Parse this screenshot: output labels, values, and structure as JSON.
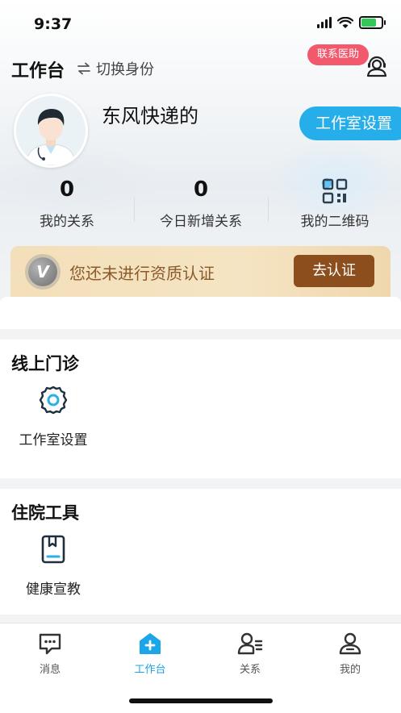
{
  "status_bar": {
    "time": "9:37"
  },
  "header": {
    "title": "工作台",
    "switch_label": "切换身份",
    "contact_label": "联系医助"
  },
  "profile": {
    "name": "东风快递的",
    "studio_button": "工作室设置"
  },
  "stats": [
    {
      "value": "0",
      "label": "我的关系"
    },
    {
      "value": "0",
      "label": "今日新增关系"
    },
    {
      "value": "",
      "label": "我的二维码"
    }
  ],
  "certification": {
    "badge": "V",
    "text": "您还未进行资质认证",
    "button": "去认证"
  },
  "sections": {
    "online_clinic": {
      "title": "线上门诊",
      "items": [
        {
          "label": "工作室设置",
          "icon": "gear-icon"
        }
      ]
    },
    "hospital_tools": {
      "title": "住院工具",
      "items": [
        {
          "label": "健康宣教",
          "icon": "book-icon"
        }
      ]
    }
  },
  "tabs": [
    {
      "label": "消息",
      "icon": "message-icon"
    },
    {
      "label": "工作台",
      "icon": "workbench-icon",
      "active": true
    },
    {
      "label": "关系",
      "icon": "relation-icon"
    },
    {
      "label": "我的",
      "icon": "profile-icon"
    }
  ],
  "colors": {
    "accent": "#26aeea",
    "badge": "#f2596d",
    "cert_button": "#8b4e1c"
  }
}
